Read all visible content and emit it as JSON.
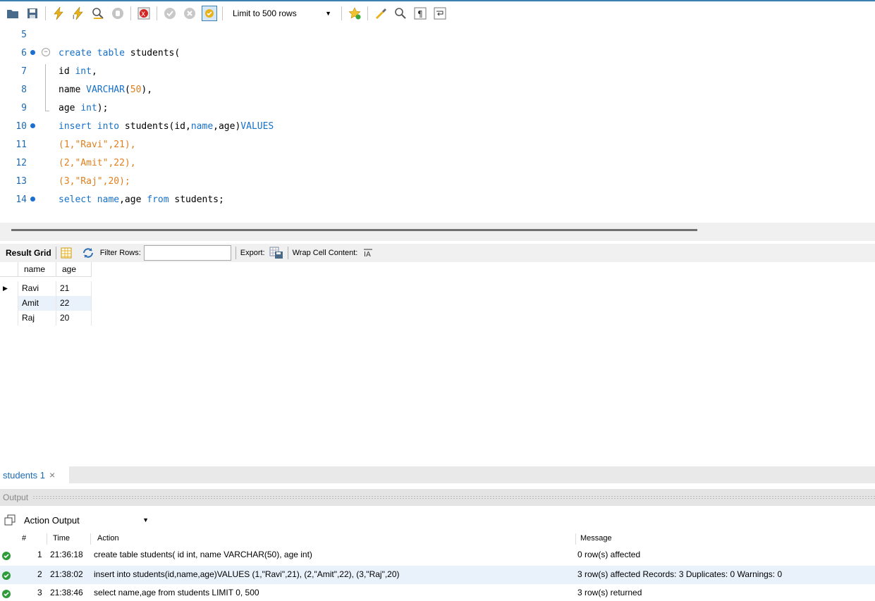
{
  "toolbar": {
    "limit_select": "Limit to 500 rows",
    "icons": [
      "open-folder-icon",
      "save-icon",
      "execute-icon",
      "execute-current-icon",
      "explain-icon",
      "stop-icon",
      "toggle-error-icon",
      "commit-icon",
      "rollback-icon",
      "autocommit-icon",
      "add-snippet-icon",
      "beautify-icon",
      "find-icon",
      "invisible-chars-icon",
      "wrap-icon"
    ]
  },
  "editor": {
    "lines": [
      {
        "num": "5"
      },
      {
        "num": "6"
      },
      {
        "num": "7"
      },
      {
        "num": "8"
      },
      {
        "num": "9"
      },
      {
        "num": "10"
      },
      {
        "num": "11"
      },
      {
        "num": "12"
      },
      {
        "num": "13"
      },
      {
        "num": "14"
      }
    ],
    "tokens": {
      "l6_kw": "create table",
      "l6_rest": " students(",
      "l7_a": "id ",
      "l7_kw": "int",
      "l7_b": ",",
      "l8_a": "name ",
      "l8_kw": "VARCHAR",
      "l8_b": "(",
      "l8_num": "50",
      "l8_c": "),",
      "l9_a": "age ",
      "l9_kw": "int",
      "l9_b": ");",
      "l10_kw": "insert into",
      "l10_a": " students(id,",
      "l10_kw2": "name",
      "l10_b": ",age)",
      "l10_kw3": "VALUES",
      "l11": "(1,\"Ravi\",21),",
      "l12": "(2,\"Amit\",22),",
      "l13": "(3,\"Raj\",20);",
      "l14_kw": "select",
      "l14_a": " ",
      "l14_kw2": "name",
      "l14_b": ",age ",
      "l14_kw3": "from",
      "l14_c": " students;"
    }
  },
  "result_toolbar": {
    "title": "Result Grid",
    "filter_label": "Filter Rows:",
    "filter_value": "",
    "export_label": "Export:",
    "wrap_label": "Wrap Cell Content:"
  },
  "grid": {
    "columns": [
      "name",
      "age"
    ],
    "rows": [
      [
        "Ravi",
        "21"
      ],
      [
        "Amit",
        "22"
      ],
      [
        "Raj",
        "20"
      ]
    ]
  },
  "tabs": {
    "active": "students 1",
    "close": "×"
  },
  "output": {
    "title": "Output",
    "selector": "Action Output",
    "columns": {
      "num": "#",
      "time": "Time",
      "action": "Action",
      "message": "Message"
    },
    "rows": [
      {
        "num": "1",
        "time": "21:36:18",
        "action": "create table students( id int, name VARCHAR(50), age int)",
        "message": "0 row(s) affected"
      },
      {
        "num": "2",
        "time": "21:38:02",
        "action": "insert into students(id,name,age)VALUES (1,\"Ravi\",21), (2,\"Amit\",22), (3,\"Raj\",20)",
        "message": "3 row(s) affected Records: 3  Duplicates: 0  Warnings: 0"
      },
      {
        "num": "3",
        "time": "21:38:46",
        "action": "select name,age from students LIMIT 0, 500",
        "message": "3 row(s) returned"
      }
    ]
  },
  "colors": {
    "keyword": "#1670c8",
    "literal": "#e07f1c",
    "line_number": "#1c6ab2",
    "success": "#2e9c3b",
    "row_highlight": "#e9f1fb"
  }
}
